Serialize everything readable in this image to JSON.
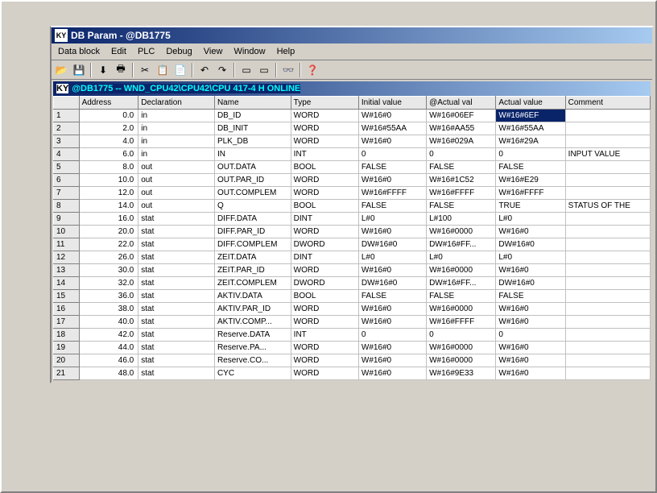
{
  "window": {
    "title": "DB Param - @DB1775"
  },
  "menu": {
    "items": [
      "Data block",
      "Edit",
      "PLC",
      "Debug",
      "View",
      "Window",
      "Help"
    ]
  },
  "subwindow": {
    "title": "@DB1775 -- WND_CPU42\\CPU42\\CPU 417-4 H  ONLINE"
  },
  "columns": [
    "",
    "Address",
    "Declaration",
    "Name",
    "Type",
    "Initial value",
    "@Actual val",
    "Actual value",
    "Comment"
  ],
  "rows": [
    {
      "n": "1",
      "addr": "0.0",
      "decl": "in",
      "name": "DB_ID",
      "type": "WORD",
      "init": "W#16#0",
      "at": "W#16#06EF",
      "actual": "W#16#6EF",
      "comment": ""
    },
    {
      "n": "2",
      "addr": "2.0",
      "decl": "in",
      "name": "DB_INIT",
      "type": "WORD",
      "init": "W#16#55AA",
      "at": "W#16#AA55",
      "actual": "W#16#55AA",
      "comment": ""
    },
    {
      "n": "3",
      "addr": "4.0",
      "decl": "in",
      "name": "PLK_DB",
      "type": "WORD",
      "init": "W#16#0",
      "at": "W#16#029A",
      "actual": "W#16#29A",
      "comment": ""
    },
    {
      "n": "4",
      "addr": "6.0",
      "decl": "in",
      "name": "IN",
      "type": "INT",
      "init": "0",
      "at": "0",
      "actual": "0",
      "comment": "INPUT VALUE"
    },
    {
      "n": "5",
      "addr": "8.0",
      "decl": "out",
      "name": "OUT.DATA",
      "type": "BOOL",
      "init": "FALSE",
      "at": "FALSE",
      "actual": "FALSE",
      "comment": ""
    },
    {
      "n": "6",
      "addr": "10.0",
      "decl": "out",
      "name": "OUT.PAR_ID",
      "type": "WORD",
      "init": "W#16#0",
      "at": "W#16#1C52",
      "actual": "W#16#E29",
      "comment": ""
    },
    {
      "n": "7",
      "addr": "12.0",
      "decl": "out",
      "name": "OUT.COMPLEM",
      "type": "WORD",
      "init": "W#16#FFFF",
      "at": "W#16#FFFF",
      "actual": "W#16#FFFF",
      "comment": ""
    },
    {
      "n": "8",
      "addr": "14.0",
      "decl": "out",
      "name": "Q",
      "type": "BOOL",
      "init": "FALSE",
      "at": "FALSE",
      "actual": "TRUE",
      "comment": "STATUS OF THE"
    },
    {
      "n": "9",
      "addr": "16.0",
      "decl": "stat",
      "name": "DIFF.DATA",
      "type": "DINT",
      "init": "L#0",
      "at": "L#100",
      "actual": "L#0",
      "comment": ""
    },
    {
      "n": "10",
      "addr": "20.0",
      "decl": "stat",
      "name": "DIFF.PAR_ID",
      "type": "WORD",
      "init": "W#16#0",
      "at": "W#16#0000",
      "actual": "W#16#0",
      "comment": ""
    },
    {
      "n": "11",
      "addr": "22.0",
      "decl": "stat",
      "name": "DIFF.COMPLEM",
      "type": "DWORD",
      "init": "DW#16#0",
      "at": "DW#16#FF...",
      "actual": "DW#16#0",
      "comment": ""
    },
    {
      "n": "12",
      "addr": "26.0",
      "decl": "stat",
      "name": "ZEIT.DATA",
      "type": "DINT",
      "init": "L#0",
      "at": "L#0",
      "actual": "L#0",
      "comment": ""
    },
    {
      "n": "13",
      "addr": "30.0",
      "decl": "stat",
      "name": "ZEIT.PAR_ID",
      "type": "WORD",
      "init": "W#16#0",
      "at": "W#16#0000",
      "actual": "W#16#0",
      "comment": ""
    },
    {
      "n": "14",
      "addr": "32.0",
      "decl": "stat",
      "name": "ZEIT.COMPLEM",
      "type": "DWORD",
      "init": "DW#16#0",
      "at": "DW#16#FF...",
      "actual": "DW#16#0",
      "comment": ""
    },
    {
      "n": "15",
      "addr": "36.0",
      "decl": "stat",
      "name": "AKTIV.DATA",
      "type": "BOOL",
      "init": "FALSE",
      "at": "FALSE",
      "actual": "FALSE",
      "comment": ""
    },
    {
      "n": "16",
      "addr": "38.0",
      "decl": "stat",
      "name": "AKTIV.PAR_ID",
      "type": "WORD",
      "init": "W#16#0",
      "at": "W#16#0000",
      "actual": "W#16#0",
      "comment": ""
    },
    {
      "n": "17",
      "addr": "40.0",
      "decl": "stat",
      "name": "AKTIV.COMP...",
      "type": "WORD",
      "init": "W#16#0",
      "at": "W#16#FFFF",
      "actual": "W#16#0",
      "comment": ""
    },
    {
      "n": "18",
      "addr": "42.0",
      "decl": "stat",
      "name": "Reserve.DATA",
      "type": "INT",
      "init": "0",
      "at": "0",
      "actual": "0",
      "comment": ""
    },
    {
      "n": "19",
      "addr": "44.0",
      "decl": "stat",
      "name": "Reserve.PA...",
      "type": "WORD",
      "init": "W#16#0",
      "at": "W#16#0000",
      "actual": "W#16#0",
      "comment": ""
    },
    {
      "n": "20",
      "addr": "46.0",
      "decl": "stat",
      "name": "Reserve.CO...",
      "type": "WORD",
      "init": "W#16#0",
      "at": "W#16#0000",
      "actual": "W#16#0",
      "comment": ""
    },
    {
      "n": "21",
      "addr": "48.0",
      "decl": "stat",
      "name": "CYC",
      "type": "WORD",
      "init": "W#16#0",
      "at": "W#16#9E33",
      "actual": "W#16#0",
      "comment": ""
    }
  ],
  "selected_cell": {
    "row": 0,
    "col": "actual"
  }
}
